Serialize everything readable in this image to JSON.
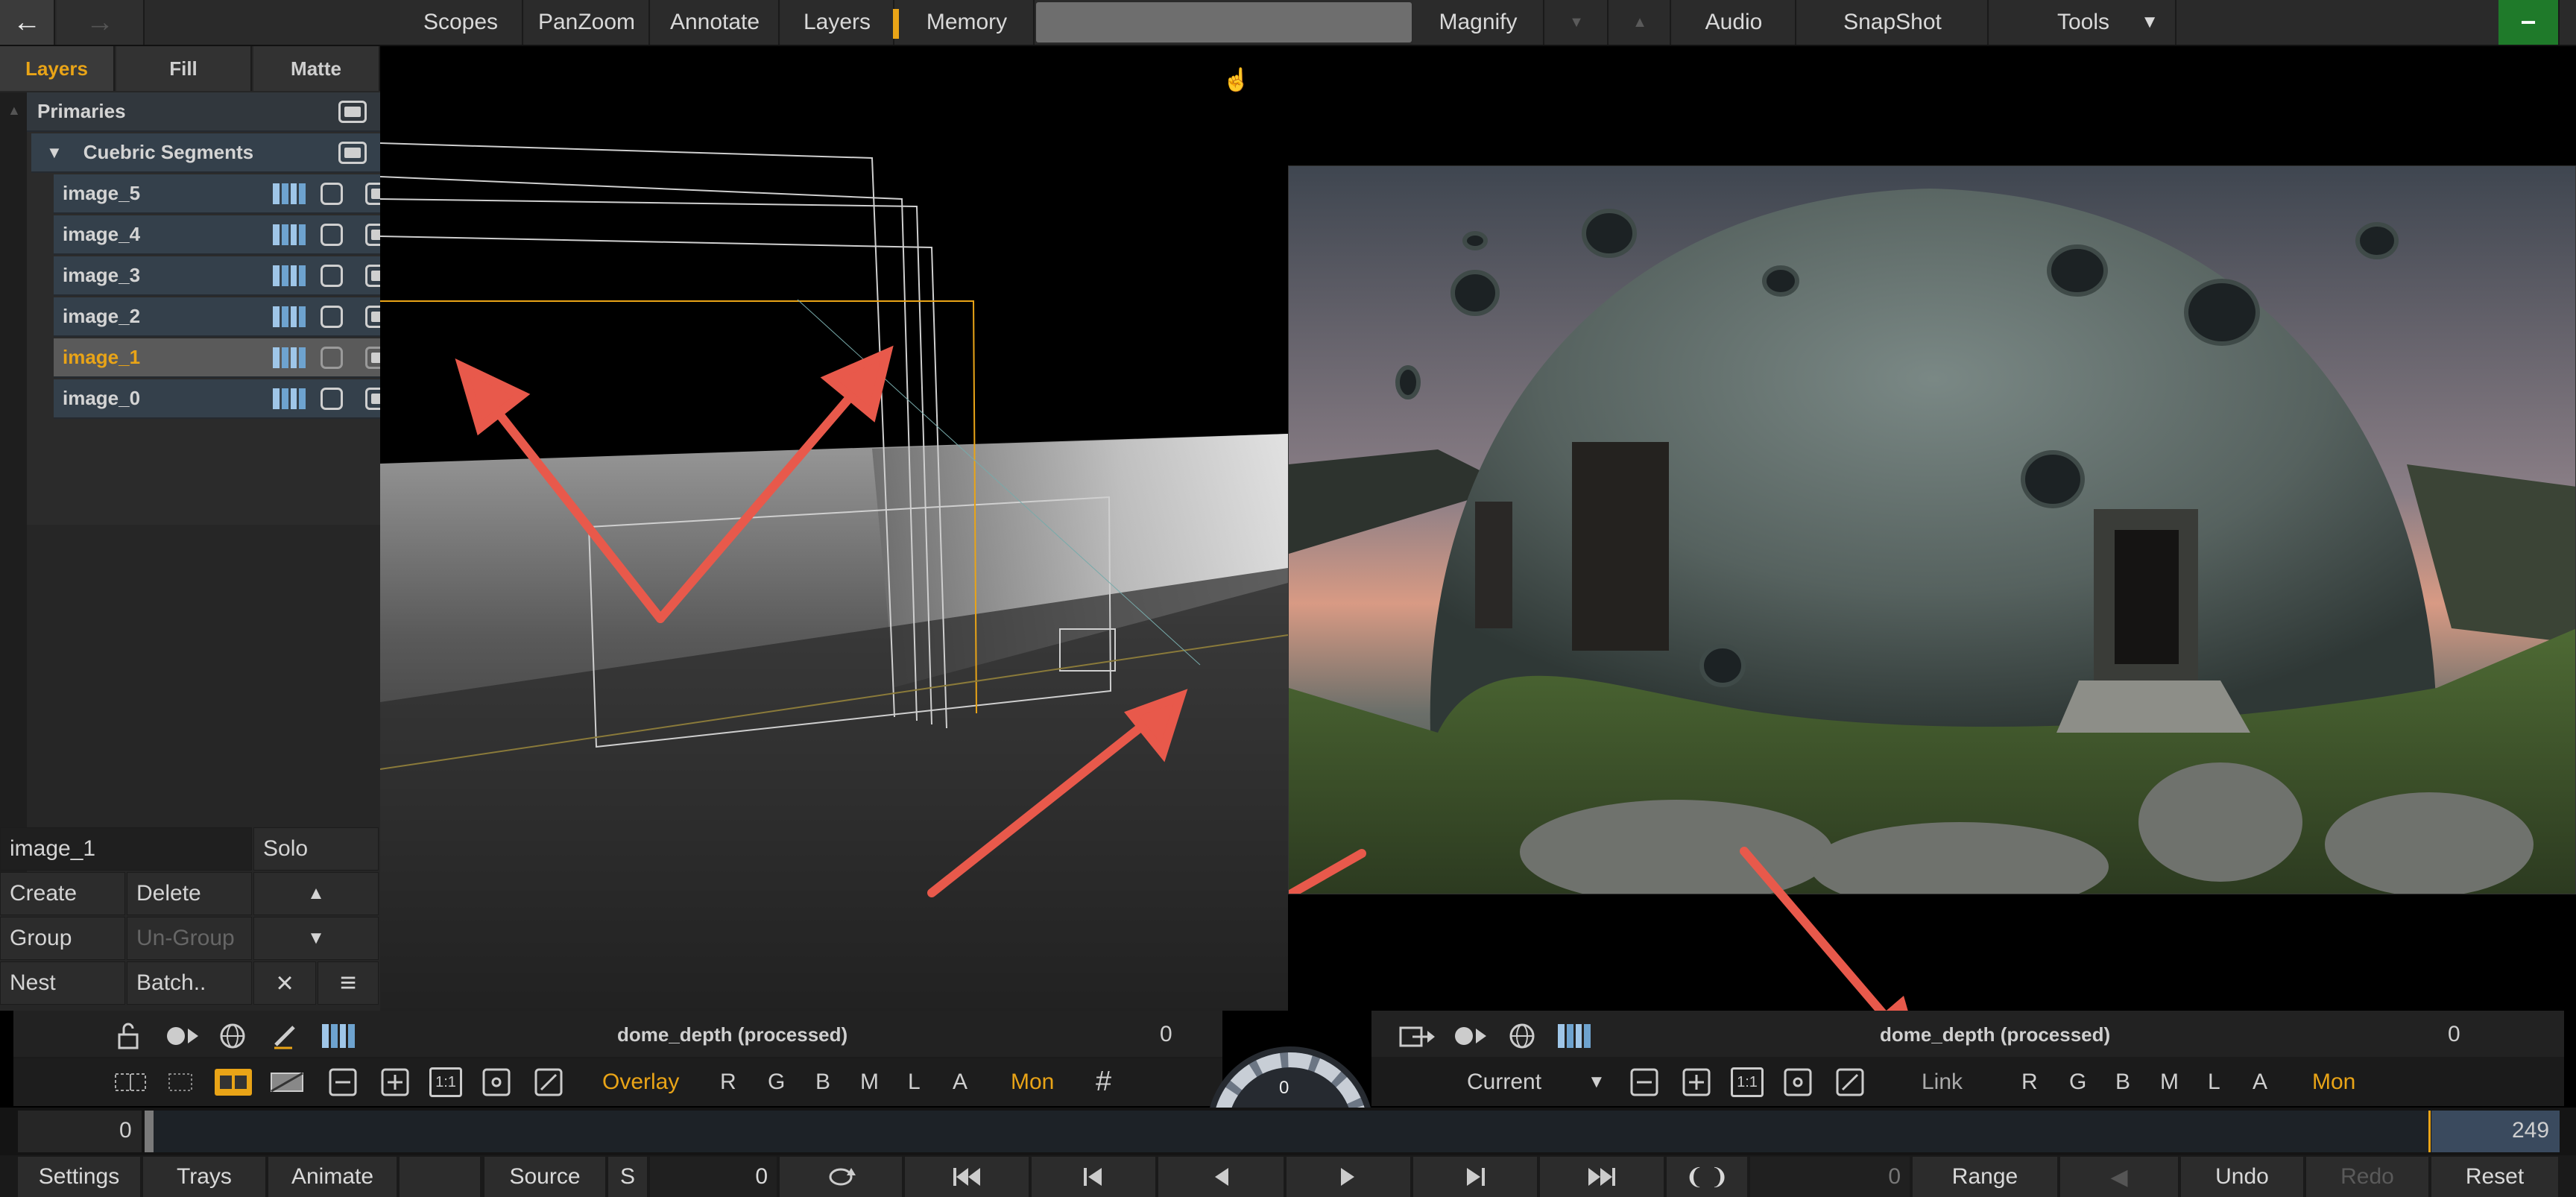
{
  "topbar": {
    "back_label": "←",
    "forward_label": "→",
    "items": [
      "Scopes",
      "PanZoom",
      "Annotate",
      "Layers",
      "Memory"
    ],
    "magnify": "Magnify",
    "audio": "Audio",
    "snapshot": "SnapShot",
    "tools": "Tools",
    "minimize": "−"
  },
  "left_panel": {
    "tabs": [
      "Layers",
      "Fill",
      "Matte"
    ],
    "active_tab": "Layers",
    "tree": {
      "group": "Primaries",
      "subgroup": "Cuebric Segments",
      "layers": [
        "image_5",
        "image_4",
        "image_3",
        "image_2",
        "image_1",
        "image_0"
      ],
      "selected": "image_1"
    },
    "selected_name": "image_1",
    "solo": "Solo",
    "create": "Create",
    "delete": "Delete",
    "group": "Group",
    "ungroup": "Un-Group",
    "nest": "Nest",
    "batch": "Batch..",
    "close": "×",
    "menu": "≡"
  },
  "viewer_left": {
    "title": "dome_depth (processed)",
    "frame": "0",
    "overlay": "Overlay",
    "channels": [
      "R",
      "G",
      "B",
      "M",
      "L",
      "A"
    ],
    "mon": "Mon",
    "grid_icon": "#"
  },
  "viewer_right": {
    "title": "dome_depth (processed)",
    "frame": "0",
    "current": "Current",
    "link": "Link",
    "channels": [
      "R",
      "G",
      "B",
      "M",
      "L",
      "A"
    ],
    "mon": "Mon"
  },
  "dial_value": "0",
  "timeline": {
    "start": "0",
    "end": "249"
  },
  "bottombar": {
    "settings": "Settings",
    "trays": "Trays",
    "animate": "Animate",
    "source": "Source",
    "s": "S",
    "frame": "0",
    "frame2": "0",
    "range": "Range",
    "undo": "Undo",
    "redo": "Redo",
    "reset": "Reset"
  },
  "colors": {
    "accent": "#e9a417",
    "arrow": "#e8594b",
    "panel": "#262626",
    "toolbar": "#2b2b2b"
  }
}
